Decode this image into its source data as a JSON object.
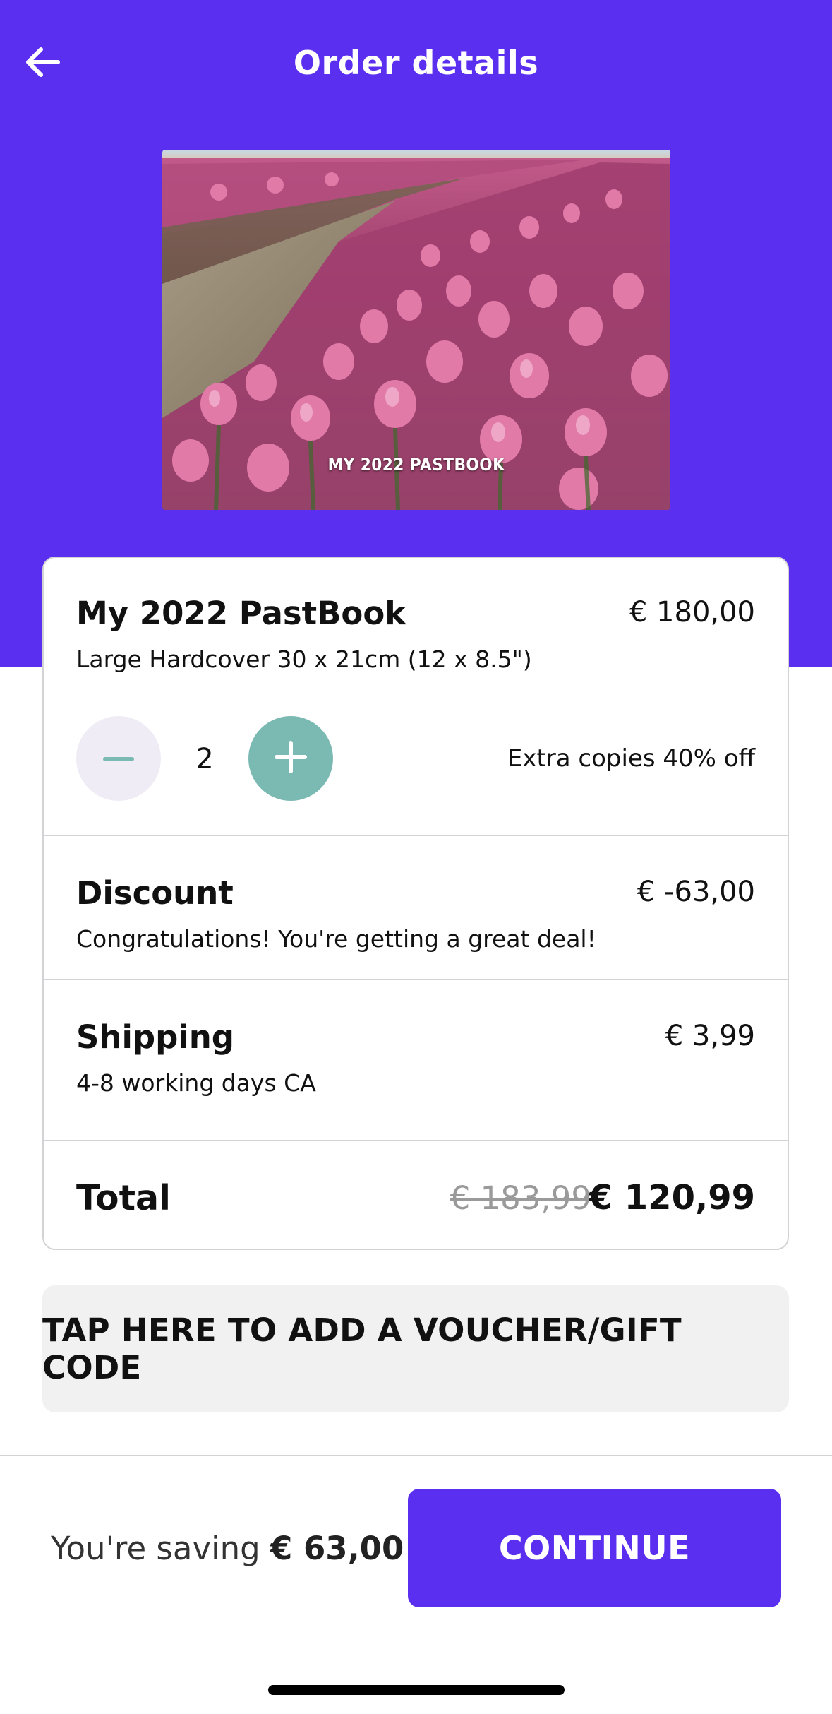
{
  "header": {
    "title": "Order details",
    "back_icon": "arrow-left-icon",
    "background_color": "#5b2fef"
  },
  "cover": {
    "title": "MY 2022 PASTBOOK"
  },
  "product": {
    "name": "My 2022 PastBook",
    "price": "€ 180,00",
    "format": "Large Hardcover 30 x 21cm (12 x 8.5\")",
    "quantity": "2",
    "extra_copies_text": "Extra copies 40% off",
    "minus_icon": "minus-icon",
    "plus_icon": "plus-icon",
    "plus_color": "#7bb9b3"
  },
  "discount": {
    "label": "Discount",
    "amount": "€ -63,00",
    "message": "Congratulations! You're getting a great deal!"
  },
  "shipping": {
    "label": "Shipping",
    "amount": "€ 3,99",
    "detail": "4-8 working days CA"
  },
  "total": {
    "label": "Total",
    "original": "€ 183,99",
    "final": "€ 120,99"
  },
  "voucher": {
    "label": "TAP HERE TO ADD A VOUCHER/GIFT CODE"
  },
  "footer": {
    "saving_prefix": "You're saving ",
    "saving_amount": "€ 63,00",
    "saving_suffix": "!",
    "continue_label": "CONTINUE",
    "accent_color": "#5b2fef"
  }
}
